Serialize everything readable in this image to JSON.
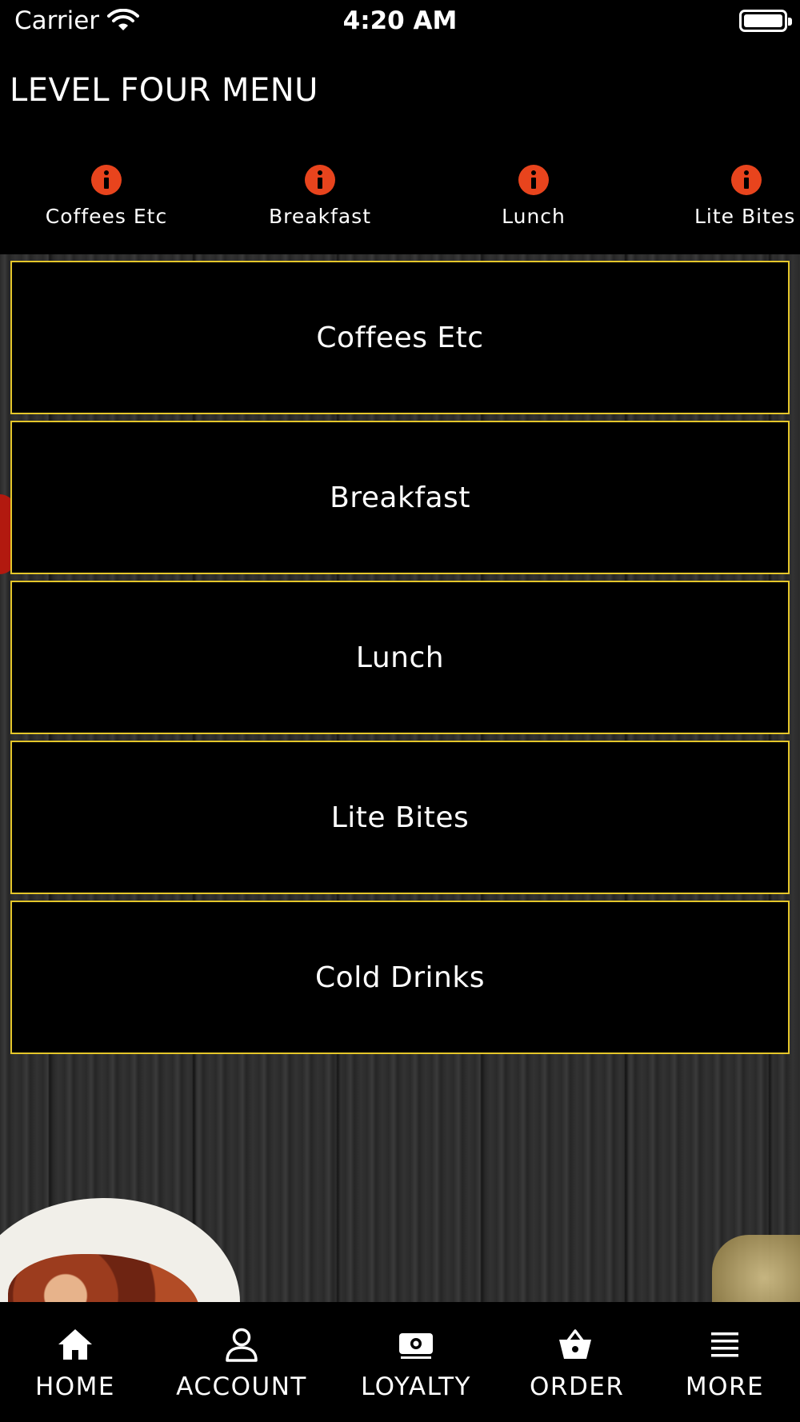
{
  "status_bar": {
    "carrier": "Carrier",
    "time": "4:20 AM"
  },
  "header": {
    "title": "LEVEL FOUR MENU"
  },
  "categories": [
    {
      "label": "Coffees Etc",
      "icon": "info-icon"
    },
    {
      "label": "Breakfast",
      "icon": "info-icon"
    },
    {
      "label": "Lunch",
      "icon": "info-icon"
    },
    {
      "label": "Lite Bites",
      "icon": "info-icon"
    }
  ],
  "menu": {
    "items": [
      "Coffees Etc",
      "Breakfast",
      "Lunch",
      "Lite Bites",
      "Cold Drinks"
    ]
  },
  "tab_bar": {
    "items": [
      {
        "label": "HOME",
        "icon": "home-icon"
      },
      {
        "label": "ACCOUNT",
        "icon": "person-icon"
      },
      {
        "label": "LOYALTY",
        "icon": "money-icon"
      },
      {
        "label": "ORDER",
        "icon": "basket-icon"
      },
      {
        "label": "MORE",
        "icon": "menu-lines-icon"
      }
    ]
  },
  "colors": {
    "accent_border": "#e4c62a",
    "info_icon": "#e8441d",
    "background": "#000000"
  }
}
